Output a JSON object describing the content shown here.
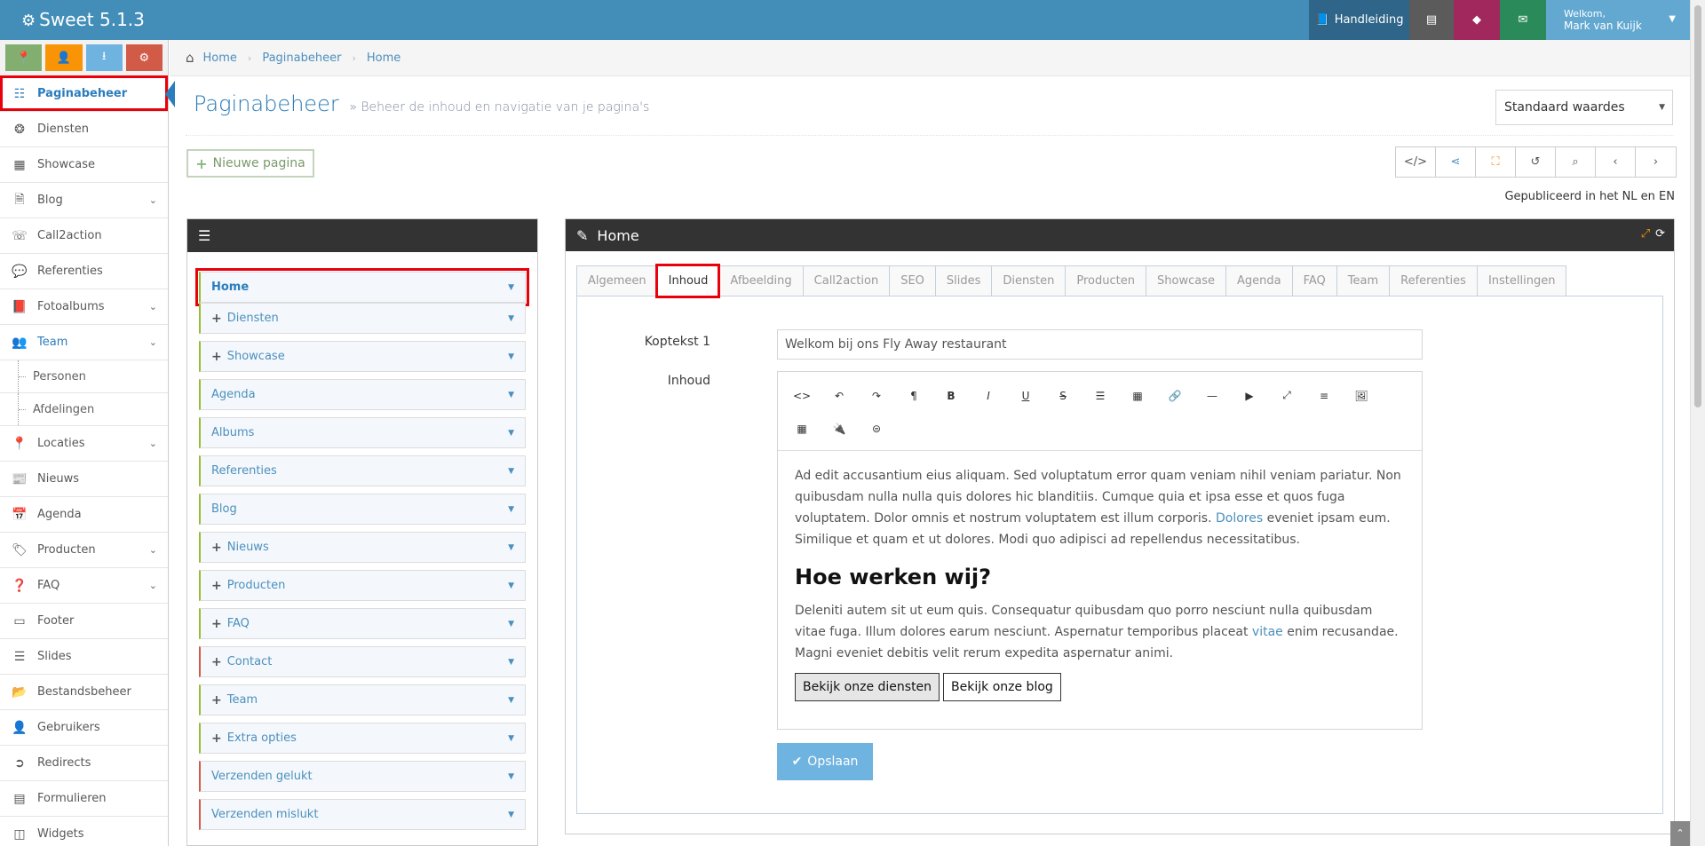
{
  "app": {
    "title": "Sweet 5.1.3"
  },
  "topbar": {
    "manual_label": "Handleiding",
    "user_greeting": "Welkom,",
    "user_name": "Mark van Kuijk",
    "colors": {
      "bar": "#438eb9",
      "manual": "#2e6589",
      "db": "#5b5b5b",
      "gem": "#a0285d",
      "mail": "#2b8a5a",
      "user": "#62a8d1"
    }
  },
  "sidebar": {
    "shortcuts": [
      {
        "icon": "map-marker-icon",
        "color": "#82af6f"
      },
      {
        "icon": "user-icon",
        "color": "#f89406"
      },
      {
        "icon": "download-icon",
        "color": "#6fb3e0"
      },
      {
        "icon": "cogs-icon",
        "color": "#d15b47"
      }
    ],
    "items": [
      {
        "label": "Paginabeheer",
        "icon": "table-icon",
        "active": true
      },
      {
        "label": "Diensten",
        "icon": "cubes-icon"
      },
      {
        "label": "Showcase",
        "icon": "grid-icon"
      },
      {
        "label": "Blog",
        "icon": "file-icon",
        "submenu": true
      },
      {
        "label": "Call2action",
        "icon": "phone-icon"
      },
      {
        "label": "Referenties",
        "icon": "comments-icon"
      },
      {
        "label": "Fotoalbums",
        "icon": "book-icon",
        "submenu": true
      },
      {
        "label": "Team",
        "icon": "users-icon",
        "submenu": true,
        "open": true
      },
      {
        "label": "Personen",
        "sub": true
      },
      {
        "label": "Afdelingen",
        "sub": true
      },
      {
        "label": "Locaties",
        "icon": "map-marker-icon",
        "submenu": true
      },
      {
        "label": "Nieuws",
        "icon": "newspaper-icon"
      },
      {
        "label": "Agenda",
        "icon": "calendar-icon"
      },
      {
        "label": "Producten",
        "icon": "tags-icon",
        "submenu": true
      },
      {
        "label": "FAQ",
        "icon": "question-circle-icon",
        "submenu": true
      },
      {
        "label": "Footer",
        "icon": "list-alt-icon"
      },
      {
        "label": "Slides",
        "icon": "sliders-icon"
      },
      {
        "label": "Bestandsbeheer",
        "icon": "folder-open-icon"
      },
      {
        "label": "Gebruikers",
        "icon": "user-icon"
      },
      {
        "label": "Redirects",
        "icon": "arrow-circle-icon"
      },
      {
        "label": "Formulieren",
        "icon": "form-icon"
      },
      {
        "label": "Widgets",
        "icon": "columns-icon"
      }
    ]
  },
  "breadcrumbs": [
    "Home",
    "Paginabeheer",
    "Home"
  ],
  "page": {
    "title": "Paginabeheer",
    "subtitle": "» Beheer de inhoud en navigatie van je pagina's",
    "defaults_select": "Standaard waardes",
    "new_page_label": "Nieuwe pagina",
    "published_text": "Gepubliceerd in het NL en EN",
    "toolbar_icons": [
      "code-icon",
      "share-icon",
      "sitemap-icon",
      "history-icon",
      "search-icon",
      "chevron-left-icon",
      "chevron-right-icon"
    ]
  },
  "tree": {
    "items": [
      {
        "label": "Home",
        "plus": false,
        "bar": "green",
        "selected": true
      },
      {
        "label": "Diensten",
        "plus": true,
        "bar": "green"
      },
      {
        "label": "Showcase",
        "plus": true,
        "bar": "green"
      },
      {
        "label": "Agenda",
        "plus": false,
        "bar": "green"
      },
      {
        "label": "Albums",
        "plus": false,
        "bar": "green"
      },
      {
        "label": "Referenties",
        "plus": false,
        "bar": "green"
      },
      {
        "label": "Blog",
        "plus": false,
        "bar": "green"
      },
      {
        "label": "Nieuws",
        "plus": true,
        "bar": "green"
      },
      {
        "label": "Producten",
        "plus": true,
        "bar": "green"
      },
      {
        "label": "FAQ",
        "plus": true,
        "bar": "green"
      },
      {
        "label": "Contact",
        "plus": true,
        "bar": "red"
      },
      {
        "label": "Team",
        "plus": true,
        "bar": "green"
      },
      {
        "label": "Extra opties",
        "plus": true,
        "bar": "green"
      },
      {
        "label": "Verzenden gelukt",
        "plus": false,
        "bar": "red"
      },
      {
        "label": "Verzenden mislukt",
        "plus": false,
        "bar": "red"
      }
    ]
  },
  "editor_panel": {
    "title": "Home",
    "tabs": [
      "Algemeen",
      "Inhoud",
      "Afbeelding",
      "Call2action",
      "SEO",
      "Slides",
      "Diensten",
      "Producten",
      "Showcase",
      "Agenda",
      "FAQ",
      "Team",
      "Referenties",
      "Instellingen"
    ],
    "active_tab": "Inhoud",
    "koptekst_label": "Koptekst 1",
    "koptekst_value": "Welkom bij ons Fly Away restaurant",
    "inhoud_label": "Inhoud",
    "toolbar_icons": [
      "code-view-icon",
      "undo-icon",
      "redo-icon",
      "paragraph-icon",
      "bold-icon",
      "italic-icon",
      "underline-icon",
      "strikethrough-icon",
      "list-icon",
      "table-icon",
      "link-icon",
      "horizontal-line-icon",
      "video-icon",
      "fullscreen-icon",
      "align-icon",
      "image-icon",
      "grid-icon",
      "plug-icon",
      "symbol-icon"
    ],
    "para1_a": "Ad edit accusantium eius aliquam. Sed voluptatum error quam veniam nihil veniam pariatur. Non quibusdam nulla nulla quis dolores hic blanditiis. Cumque quia et ipsa esse et quos fuga voluptatem. Dolor omnis et nostrum voluptatem est illum corporis. ",
    "para1_link": "Dolores",
    "para1_b": " eveniet ipsam eum. Similique et quam et ut dolores. Modi quo adipisci ad repellendus necessitatibus.",
    "heading": "Hoe werken wij?",
    "para2_a": "Deleniti autem sit ut eum quis. Consequatur quibusdam quo porro nesciunt nulla quibusdam vitae fuga. Illum dolores earum nesciunt. Aspernatur temporibus placeat ",
    "para2_link": "vitae",
    "para2_b": " enim recusandae. Magni eveniet debitis velit rerum expedita aspernatur animi.",
    "btn1": "Bekijk onze diensten",
    "btn2": "Bekijk onze blog",
    "save_label": "Opslaan"
  }
}
